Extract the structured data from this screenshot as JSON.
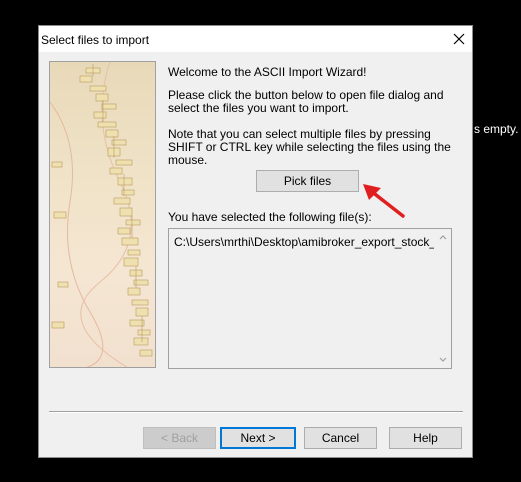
{
  "background": {
    "behind_text": "s empty."
  },
  "dialog": {
    "title": "Select files to import",
    "welcome": "Welcome to the ASCII Import Wizard!",
    "instructions": "Please click the button below to open file dialog and select the files you want to import.",
    "note": "Note that you can select multiple files by pressing SHIFT or CTRL key while selecting the files using the mouse.",
    "pick_files_label": "Pick files",
    "selected_label": "You have selected the following file(s):",
    "selected_files": [
      "C:\\Users\\mrthi\\Desktop\\amibroker_export_stock_TCE"
    ],
    "buttons": {
      "back": "< Back",
      "next": "Next >",
      "cancel": "Cancel",
      "help": "Help"
    }
  },
  "colors": {
    "accent": "#0078d7",
    "annotation_arrow": "#e02020"
  }
}
